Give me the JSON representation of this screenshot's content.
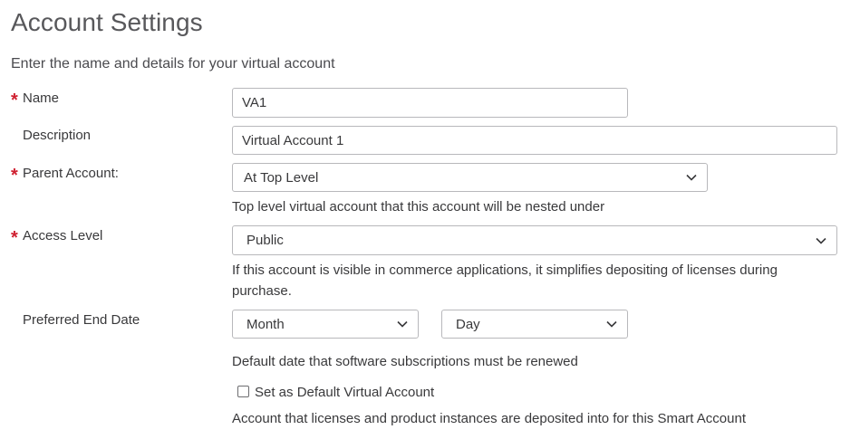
{
  "page": {
    "title": "Account Settings",
    "subtitle": "Enter the name and details for your virtual account"
  },
  "form": {
    "name": {
      "label": "Name",
      "required": true,
      "value": "VA1"
    },
    "description": {
      "label": "Description",
      "required": false,
      "value": "Virtual Account 1"
    },
    "parent_account": {
      "label": "Parent Account:",
      "required": true,
      "selected": "At Top Level",
      "help": "Top level virtual account that this account will be nested under"
    },
    "access_level": {
      "label": "Access Level",
      "required": true,
      "selected": "Public",
      "help": "If this account is visible in commerce applications, it simplifies depositing of licenses during purchase."
    },
    "preferred_end_date": {
      "label": "Preferred End Date",
      "month_selected": "Month",
      "day_selected": "Day",
      "help": "Default date that software subscriptions must be renewed"
    },
    "default_account": {
      "label": "Set as Default Virtual Account",
      "checked": false,
      "help": "Account that licenses and product instances are deposited into for this Smart Account"
    }
  },
  "icons": {
    "required_marker": "*",
    "dropdown": "chevron-down-icon"
  },
  "colors": {
    "required": "#cf2030",
    "text": "#39393b",
    "border": "#b8b8bb"
  }
}
